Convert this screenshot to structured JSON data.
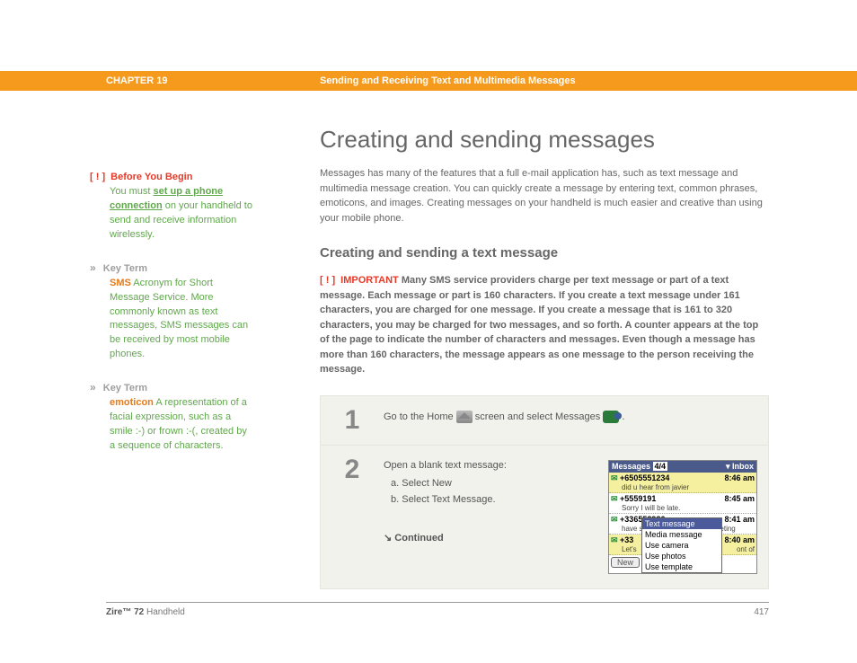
{
  "header": {
    "chapter": "CHAPTER 19",
    "title": "Sending and Receiving Text and Multimedia Messages"
  },
  "sidebar": {
    "before": {
      "marker": "[ ! ]",
      "title": "Before You Begin",
      "pre": "You must ",
      "link": "set up a phone connection",
      "post": " on your handheld to send and receive information wirelessly."
    },
    "term1": {
      "marker": "»",
      "title": "Key Term",
      "term": "SMS",
      "body": " Acronym for Short Message Service. More commonly known as text messages, SMS messages can be received by most mobile phones."
    },
    "term2": {
      "marker": "»",
      "title": "Key Term",
      "term": "emoticon",
      "body": " A representation of a facial expression, such as a smile :-) or frown :-(, created by a sequence of characters."
    }
  },
  "main": {
    "h1": "Creating and sending messages",
    "intro": "Messages has many of the features that a full e-mail application has, such as text message and multimedia message creation. You can quickly create a message by entering text, common phrases, emoticons, and images. Creating messages on your handheld is much easier and creative than using your mobile phone.",
    "h2": "Creating and sending a text message",
    "important": {
      "marker": "[ ! ]",
      "label": "IMPORTANT",
      "body": "Many SMS service providers charge per text message or part of a text message. Each message or part is 160 characters. If you create a text message under 161 characters, you are charged for one message. If you create a message that is 161 to 320 characters, you may be charged for two messages, and so forth. A counter appears at the top of the page to indicate the number of characters and messages. Even though a message has more than 160 characters, the message appears as one message to the person receiving the message."
    }
  },
  "steps": {
    "s1": {
      "num": "1",
      "pre": "Go to the Home ",
      "mid": " screen and select Messages ",
      "post": "."
    },
    "s2": {
      "num": "2",
      "intro": "Open a blank text message:",
      "a": "a.  Select New",
      "b": "b.  Select Text Message.",
      "continued": "Continued"
    }
  },
  "screenshot": {
    "title_left": "Messages",
    "title_mid": "4/4",
    "title_right": "▾ Inbox",
    "items": [
      {
        "num": "+6505551234",
        "time": "8:46 am",
        "msg": "did u hear from javier",
        "hl": true
      },
      {
        "num": "+5559191",
        "time": "8:45 am",
        "msg": "Sorry I will be late.",
        "hl": false
      },
      {
        "num": "+336558986",
        "time": "8:41 am",
        "msg": "have some ideas about the meeting",
        "hl": false
      },
      {
        "num": "+33",
        "time": "8:40 am",
        "msg": "Let's",
        "hl": true,
        "trail": "ont of"
      }
    ],
    "menu": [
      "Text message",
      "Media message",
      "Use camera",
      "Use photos",
      "Use template"
    ],
    "newbtn": "New"
  },
  "footer": {
    "product_bold": "Zire™ 72",
    "product_rest": " Handheld",
    "page": "417"
  }
}
